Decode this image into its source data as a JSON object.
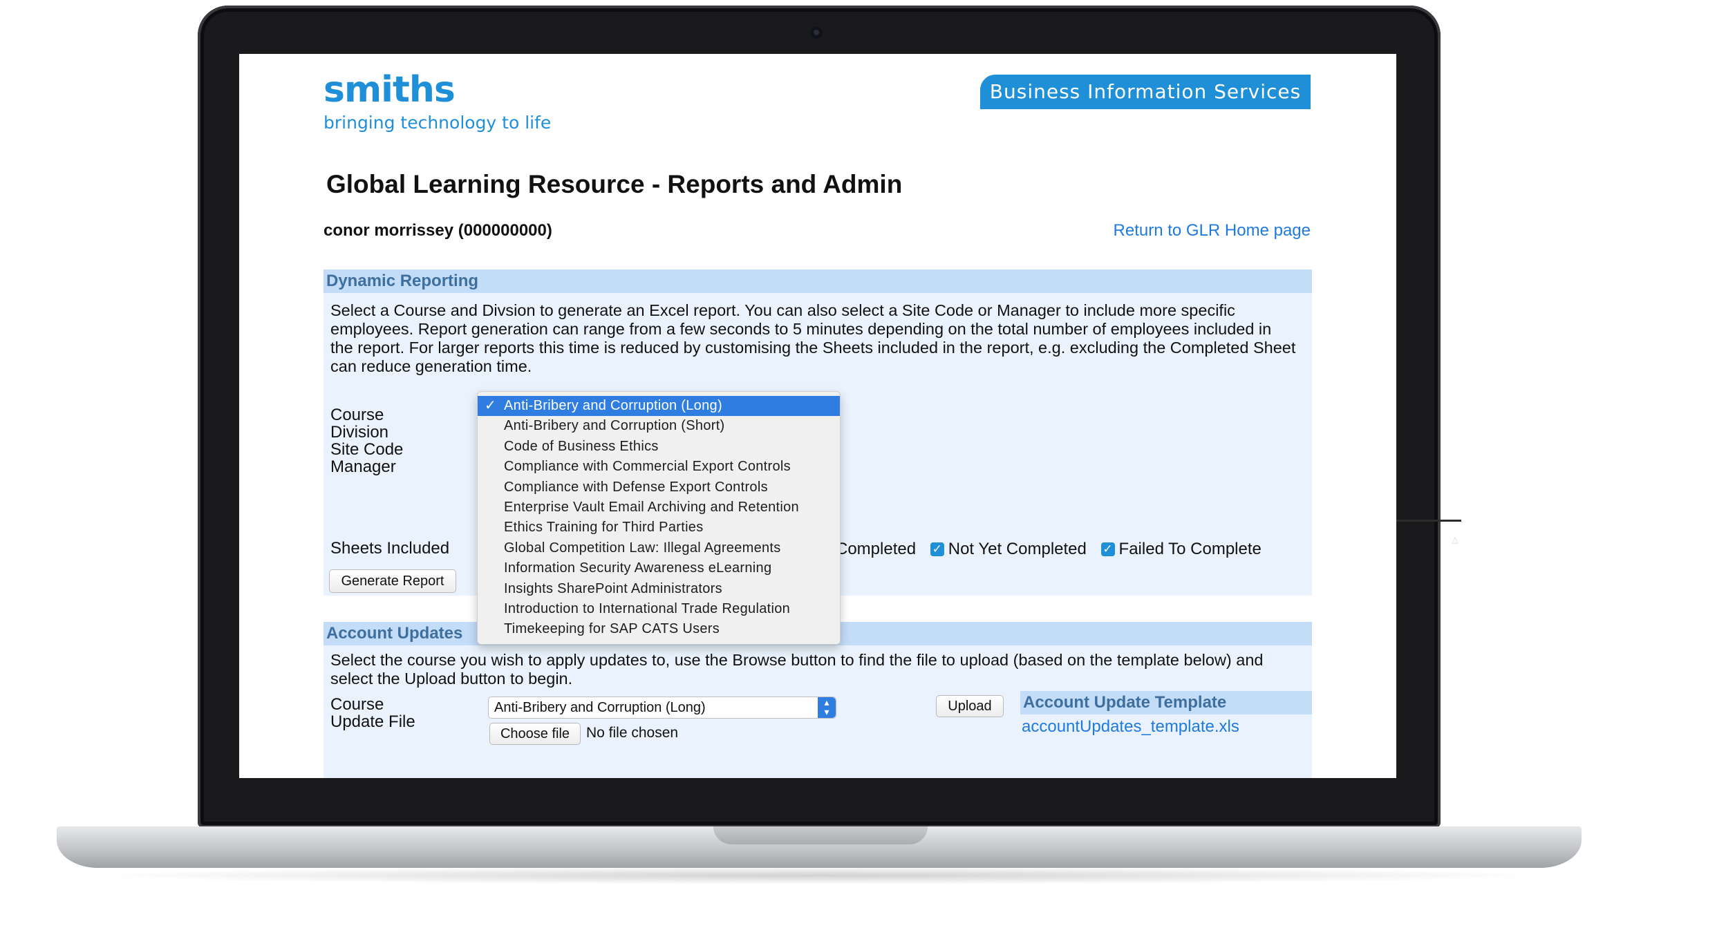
{
  "header": {
    "logo_word": "smiths",
    "logo_tagline": "bringing technology to life",
    "banner": "Business Information Services"
  },
  "page": {
    "title": "Global Learning Resource - Reports and Admin",
    "user": "conor morrissey (000000000)",
    "home_link": "Return to GLR Home page"
  },
  "dynamic_reporting": {
    "heading": "Dynamic Reporting",
    "description": "Select a Course and Divsion to generate an Excel report. You can also select a Site Code or Manager to include more specific employees. Report generation can range from a few seconds to 5 minutes depending on the total number of employees included in the report. For larger reports this time is reduced by customising the Sheets included in the report, e.g. excluding the Completed Sheet can reduce generation time.",
    "labels": {
      "course": "Course",
      "division": "Division",
      "site_code": "Site Code",
      "manager": "Manager",
      "sheets": "Sheets Included"
    },
    "sheets": [
      {
        "label": "Completed",
        "checked": true
      },
      {
        "label": "Not Yet Completed",
        "checked": true
      },
      {
        "label": "Failed To Complete",
        "checked": true
      }
    ],
    "generate_button": "Generate Report",
    "course_options": [
      "Anti-Bribery and Corruption (Long)",
      "Anti-Bribery and Corruption (Short)",
      "Code of Business Ethics",
      "Compliance with Commercial Export Controls",
      "Compliance with Defense Export Controls",
      "Enterprise Vault Email Archiving and Retention",
      "Ethics Training for Third Parties",
      "Global Competition Law: Illegal Agreements",
      "Information Security Awareness eLearning",
      "Insights SharePoint Administrators",
      "Introduction to International Trade Regulation",
      "Timekeeping for SAP CATS Users"
    ],
    "selected_index": 0,
    "check_glyph": "✓"
  },
  "account_updates": {
    "heading": "Account Updates",
    "description": "Select the course you wish to apply updates to, use the Browse button to find the file to upload (based on the template below) and select the Upload button to begin.",
    "labels": {
      "course": "Course",
      "update_file": "Update File"
    },
    "course_value": "Anti-Bribery and Corruption (Long)",
    "choose_file_button": "Choose file",
    "no_file_text": "No file chosen",
    "upload_button": "Upload",
    "template_heading": "Account Update Template",
    "template_link": "accountUpdates_template.xls"
  },
  "colors": {
    "brand_blue": "#1f8fd8",
    "panel_bg": "#eaf3fd",
    "panel_header": "#c3dcf7",
    "link": "#1f7ae0",
    "selection": "#2f7de1"
  },
  "icons": [
    "check-icon",
    "select-arrow-icon",
    "camera-icon"
  ]
}
